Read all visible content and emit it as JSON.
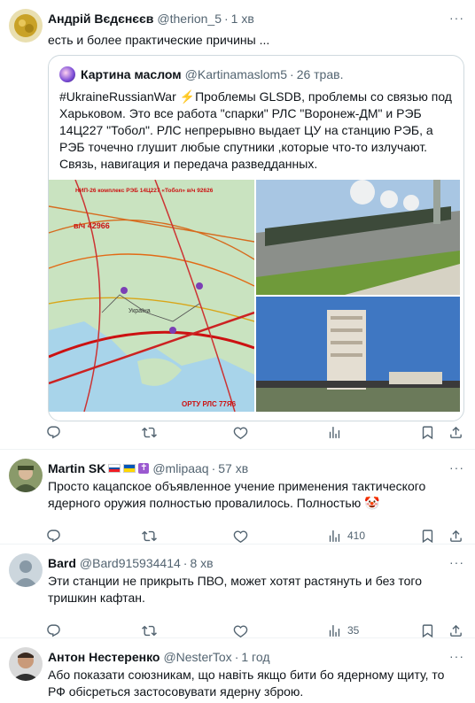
{
  "posts": [
    {
      "name": "Андрій Вєдєнєєв",
      "handle": "@therion_5",
      "dot": "·",
      "time": "1 хв",
      "text": "есть и более практические причины ...",
      "more": "···",
      "quote": {
        "name": "Картина маслом",
        "handle": "@Kartinamaslom5",
        "dot": "·",
        "time": "26 трав.",
        "text": "#UkraineRussianWar ⚡Проблемы GLSDB, проблемы со связью под Харьковом. Это все работа \"спарки\" РЛС \"Воронеж-ДМ\" и РЭБ 14Ц227 \"Тобол\". РЛС непрерывно выдает ЦУ на станцию РЭБ, а РЭБ точечно глушит любые спутники ,которые что-то излучают. Связь, навигация и передача разведданных.",
        "map_title": "НИП-26 комплекс РЭБ 14Ц227 «Тобол» в/ч 92626",
        "map_sub": "в/ч 42966",
        "map_label_ukraine": "Україна",
        "map_footer": "ОРТУ РЛС 77Я6"
      }
    },
    {
      "name": "Martin SK",
      "handle": "@mlipaaq",
      "dot": "·",
      "time": "57 хв",
      "more": "···",
      "text": "Просто кацапское объявленное учение применения тактического ядерного оружия полностью провалилось. Полностью 🤡",
      "views": "410"
    },
    {
      "name": "Bard",
      "handle": "@Bard915934414",
      "dot": "·",
      "time": "8 хв",
      "more": "···",
      "text": "Эти станции не прикрыть ПВО, может хотят растянуть и без того тришкин кафтан.",
      "views": "35"
    },
    {
      "name": "Антон Нестеренко",
      "handle": "@NesterTox",
      "dot": "·",
      "time": "1 год",
      "more": "···",
      "text": "Або показати союзникам, що навіть якщо бити бо ядерному щиту, то РФ обісреться застосовувати ядерну зброю."
    }
  ],
  "icons": [
    "reply-icon",
    "retweet-icon",
    "like-icon",
    "views-icon",
    "bookmark-icon",
    "share-icon"
  ],
  "colors": {
    "text": "#0f1419",
    "secondary": "#536471",
    "border": "#eff3f4",
    "link": "#1d9bf0"
  }
}
